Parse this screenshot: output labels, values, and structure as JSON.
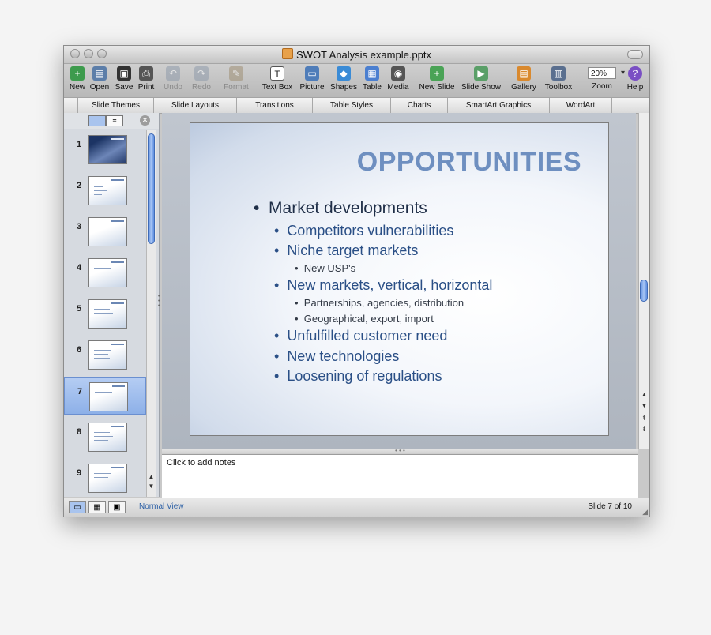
{
  "window": {
    "title": "SWOT Analysis example.pptx"
  },
  "toolbar": {
    "items": [
      {
        "label": "New",
        "icon": "new-icon"
      },
      {
        "label": "Open",
        "icon": "open-icon"
      },
      {
        "label": "Save",
        "icon": "save-icon"
      },
      {
        "label": "Print",
        "icon": "print-icon"
      },
      {
        "label": "Undo",
        "icon": "undo-icon",
        "disabled": true
      },
      {
        "label": "Redo",
        "icon": "redo-icon",
        "disabled": true
      },
      {
        "label": "Format",
        "icon": "format-brush-icon",
        "disabled": true
      },
      {
        "label": "Text Box",
        "icon": "text-box-icon"
      },
      {
        "label": "Picture",
        "icon": "picture-icon"
      },
      {
        "label": "Shapes",
        "icon": "shapes-icon"
      },
      {
        "label": "Table",
        "icon": "table-icon"
      },
      {
        "label": "Media",
        "icon": "media-icon"
      },
      {
        "label": "New Slide",
        "icon": "new-slide-icon"
      },
      {
        "label": "Slide Show",
        "icon": "slide-show-icon"
      },
      {
        "label": "Gallery",
        "icon": "gallery-icon"
      },
      {
        "label": "Toolbox",
        "icon": "toolbox-icon"
      },
      {
        "label": "Help",
        "icon": "help-icon"
      }
    ],
    "zoom": {
      "label": "Zoom",
      "value": "20%"
    }
  },
  "ribbon": {
    "tabs": [
      "Slide Themes",
      "Slide Layouts",
      "Transitions",
      "Table Styles",
      "Charts",
      "SmartArt Graphics",
      "WordArt"
    ]
  },
  "slides": {
    "numbers": [
      "1",
      "2",
      "3",
      "4",
      "5",
      "6",
      "7",
      "8",
      "9"
    ],
    "selected_index": 7
  },
  "slide": {
    "title": "OPPORTUNITIES",
    "bullets": [
      {
        "text": "Market developments",
        "level": 1
      },
      {
        "text": "Competitors vulnerabilities",
        "level": 2
      },
      {
        "text": "Niche target markets",
        "level": 2
      },
      {
        "text": "New USP's",
        "level": 3
      },
      {
        "text": "New markets, vertical, horizontal",
        "level": 2
      },
      {
        "text": "Partnerships, agencies, distribution",
        "level": 3
      },
      {
        "text": "Geographical, export, import",
        "level": 3
      },
      {
        "text": "Unfulfilled customer need",
        "level": 2
      },
      {
        "text": "New technologies",
        "level": 2
      },
      {
        "text": "Loosening of regulations",
        "level": 2
      }
    ]
  },
  "notes": {
    "placeholder": "Click to add notes"
  },
  "status": {
    "view": "Normal View",
    "slide_indicator": "Slide 7 of 10"
  },
  "colors": {
    "title_blue": "#6e8fc0",
    "selection_blue": "#8db0e8",
    "accent_blue": "#2a4f86"
  }
}
